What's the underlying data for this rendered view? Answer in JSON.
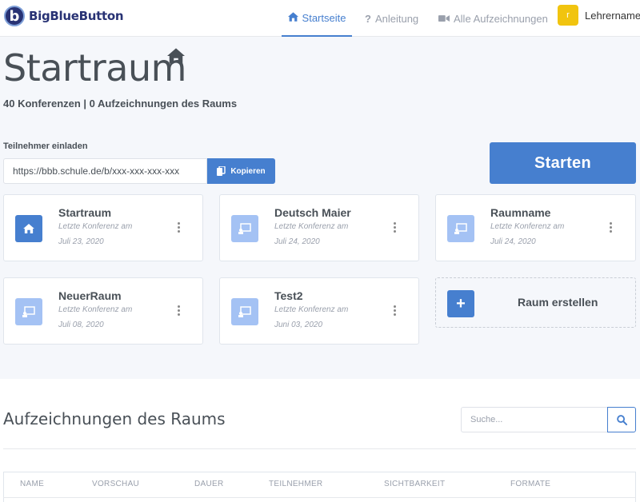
{
  "header": {
    "brand": "BigBlueButton",
    "logo_letter": "b",
    "nav": {
      "home": "Startseite",
      "help": "Anleitung",
      "recordings": "Alle Aufzeichnungen"
    },
    "user": {
      "initial": "r",
      "name": "Lehrername"
    }
  },
  "room": {
    "title": "Startraum",
    "summary": "40 Konferenzen | 0 Aufzeichnungen des Raums",
    "invite_label": "Teilnehmer einladen",
    "invite_url": "https://bbb.schule.de/b/xxx-xxx-xxx-xxx",
    "copy_label": "Kopieren",
    "start_label": "Starten"
  },
  "rooms": [
    {
      "name": "Startraum",
      "last": "Letzte Konferenz am",
      "date": "Juli 23, 2020",
      "icon": "home-icon"
    },
    {
      "name": "Deutsch Maier",
      "last": "Letzte Konferenz am",
      "date": "Juli 24, 2020",
      "icon": "presentation-icon"
    },
    {
      "name": "Raumname",
      "last": "Letzte Konferenz am",
      "date": "Juli 24, 2020",
      "icon": "presentation-icon"
    },
    {
      "name": "NeuerRaum",
      "last": "Letzte Konferenz am",
      "date": "Juli 08, 2020",
      "icon": "presentation-icon"
    },
    {
      "name": "Test2",
      "last": "Letzte Konferenz am",
      "date": "Juni 03, 2020",
      "icon": "presentation-icon"
    }
  ],
  "create_room": {
    "label": "Raum erstellen",
    "icon": "plus-icon"
  },
  "recordings": {
    "title": "Aufzeichnungen des Raums",
    "search_placeholder": "Suche...",
    "columns": [
      "NAME",
      "VORSCHAU",
      "DAUER",
      "TEILNEHMER",
      "SICHTBARKEIT",
      "FORMATE"
    ]
  },
  "colors": {
    "accent": "#467fcf",
    "accent_light": "#a4c2f4",
    "brand": "#283274",
    "avatar": "#f1c40f"
  }
}
